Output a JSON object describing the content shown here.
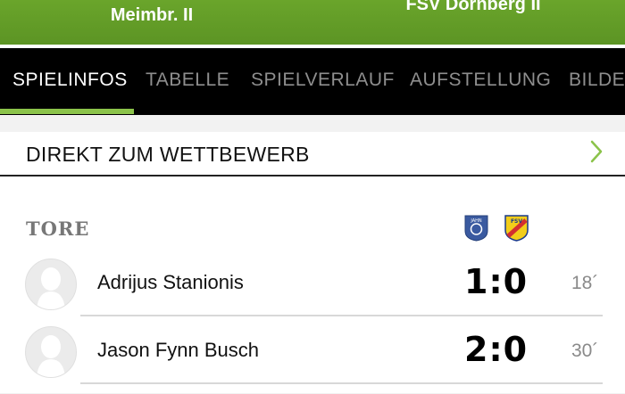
{
  "match": {
    "home_team_line": "Meimbr. II",
    "away_team_line": "FSV Dornberg II"
  },
  "tabs": [
    {
      "label": "SPIELINFOS",
      "active": true
    },
    {
      "label": "TABELLE",
      "active": false
    },
    {
      "label": "SPIELVERLAUF",
      "active": false
    },
    {
      "label": "AUFSTELLUNG",
      "active": false
    },
    {
      "label": "BILDER",
      "active": false
    }
  ],
  "competition_link": {
    "label": "DIREKT ZUM WETTBEWERB",
    "icon": "chevron-right-icon"
  },
  "goals": {
    "title": "TORE",
    "home_crest_text": "JAHN",
    "away_crest_text": "FSV",
    "items": [
      {
        "scorer": "Adrijus Stanionis",
        "score": "1:0",
        "minute": "18´"
      },
      {
        "scorer": "Jason Fynn Busch",
        "score": "2:0",
        "minute": "30´"
      }
    ]
  },
  "colors": {
    "header_green": "#62a028",
    "tab_bg": "#000000",
    "tab_indicator": "#8bc34a",
    "chevron": "#8bc34a"
  }
}
